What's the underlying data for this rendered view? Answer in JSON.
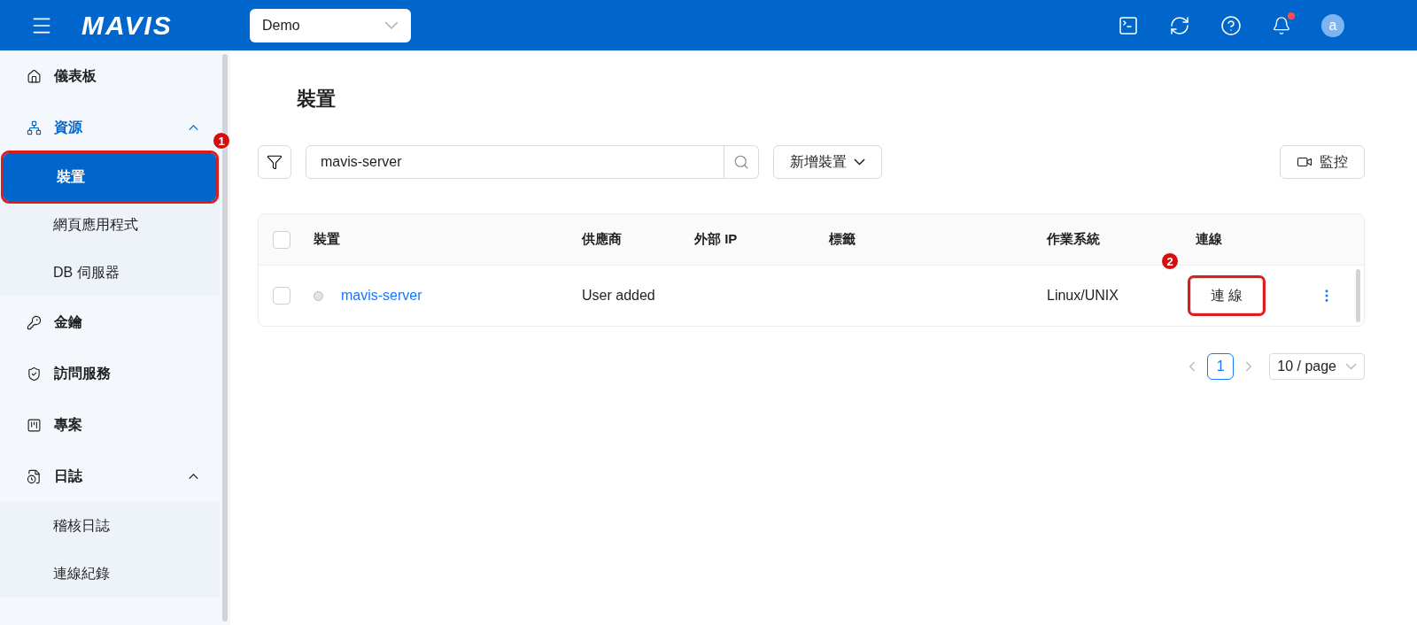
{
  "header": {
    "logo": "MAVIS",
    "project_select": {
      "value": "Demo"
    },
    "notifications_unread": true,
    "avatar": "a"
  },
  "sidebar": {
    "items": [
      {
        "label": "儀表板",
        "selected": false
      },
      {
        "label": "資源",
        "selected": true,
        "expanded": true,
        "children": [
          {
            "label": "裝置",
            "selected": true,
            "callout": "1"
          },
          {
            "label": "網頁應用程式",
            "selected": false
          },
          {
            "label": "DB 伺服器",
            "selected": false
          }
        ]
      },
      {
        "label": "金鑰",
        "selected": false
      },
      {
        "label": "訪問服務",
        "selected": false
      },
      {
        "label": "專案",
        "selected": false
      },
      {
        "label": "日誌",
        "selected": false,
        "expanded": true,
        "children": [
          {
            "label": "稽核日誌",
            "selected": false
          },
          {
            "label": "連線紀錄",
            "selected": false
          }
        ]
      }
    ]
  },
  "page_title": "裝置",
  "toolbar": {
    "search": {
      "value": "mavis-server"
    },
    "add_button": "新增裝置",
    "monitor_button": "監控"
  },
  "table": {
    "columns": [
      "裝置",
      "供應商",
      "外部 IP",
      "標籤",
      "作業系統",
      "連線"
    ],
    "all_checked": false,
    "rows": [
      {
        "checked": false,
        "online": false,
        "name": "mavis-server",
        "vendor": "User added",
        "os": "Linux/UNIX",
        "connect": "連 線",
        "callout": "2"
      }
    ]
  },
  "pagination": {
    "pages": [
      {
        "label": "1",
        "selected": true
      }
    ],
    "page_size": "10 / page"
  }
}
